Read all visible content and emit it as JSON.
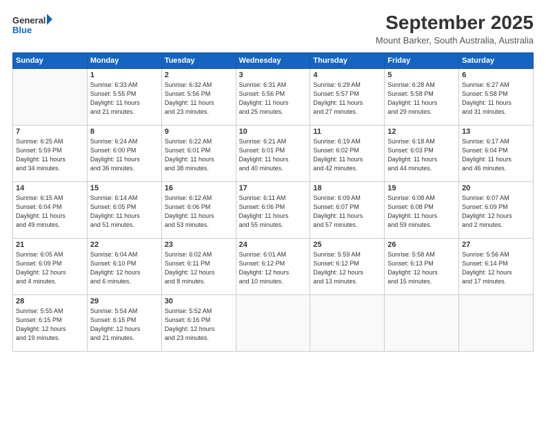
{
  "header": {
    "logo_line1": "General",
    "logo_line2": "Blue",
    "month": "September 2025",
    "location": "Mount Barker, South Australia, Australia"
  },
  "days_of_week": [
    "Sunday",
    "Monday",
    "Tuesday",
    "Wednesday",
    "Thursday",
    "Friday",
    "Saturday"
  ],
  "weeks": [
    [
      {
        "day": "",
        "info": ""
      },
      {
        "day": "1",
        "info": "Sunrise: 6:33 AM\nSunset: 5:55 PM\nDaylight: 11 hours\nand 21 minutes."
      },
      {
        "day": "2",
        "info": "Sunrise: 6:32 AM\nSunset: 5:56 PM\nDaylight: 11 hours\nand 23 minutes."
      },
      {
        "day": "3",
        "info": "Sunrise: 6:31 AM\nSunset: 5:56 PM\nDaylight: 11 hours\nand 25 minutes."
      },
      {
        "day": "4",
        "info": "Sunrise: 6:29 AM\nSunset: 5:57 PM\nDaylight: 11 hours\nand 27 minutes."
      },
      {
        "day": "5",
        "info": "Sunrise: 6:28 AM\nSunset: 5:58 PM\nDaylight: 11 hours\nand 29 minutes."
      },
      {
        "day": "6",
        "info": "Sunrise: 6:27 AM\nSunset: 5:58 PM\nDaylight: 11 hours\nand 31 minutes."
      }
    ],
    [
      {
        "day": "7",
        "info": "Sunrise: 6:25 AM\nSunset: 5:59 PM\nDaylight: 11 hours\nand 34 minutes."
      },
      {
        "day": "8",
        "info": "Sunrise: 6:24 AM\nSunset: 6:00 PM\nDaylight: 11 hours\nand 36 minutes."
      },
      {
        "day": "9",
        "info": "Sunrise: 6:22 AM\nSunset: 6:01 PM\nDaylight: 11 hours\nand 38 minutes."
      },
      {
        "day": "10",
        "info": "Sunrise: 6:21 AM\nSunset: 6:01 PM\nDaylight: 11 hours\nand 40 minutes."
      },
      {
        "day": "11",
        "info": "Sunrise: 6:19 AM\nSunset: 6:02 PM\nDaylight: 11 hours\nand 42 minutes."
      },
      {
        "day": "12",
        "info": "Sunrise: 6:18 AM\nSunset: 6:03 PM\nDaylight: 11 hours\nand 44 minutes."
      },
      {
        "day": "13",
        "info": "Sunrise: 6:17 AM\nSunset: 6:04 PM\nDaylight: 11 hours\nand 46 minutes."
      }
    ],
    [
      {
        "day": "14",
        "info": "Sunrise: 6:15 AM\nSunset: 6:04 PM\nDaylight: 11 hours\nand 49 minutes."
      },
      {
        "day": "15",
        "info": "Sunrise: 6:14 AM\nSunset: 6:05 PM\nDaylight: 11 hours\nand 51 minutes."
      },
      {
        "day": "16",
        "info": "Sunrise: 6:12 AM\nSunset: 6:06 PM\nDaylight: 11 hours\nand 53 minutes."
      },
      {
        "day": "17",
        "info": "Sunrise: 6:11 AM\nSunset: 6:06 PM\nDaylight: 11 hours\nand 55 minutes."
      },
      {
        "day": "18",
        "info": "Sunrise: 6:09 AM\nSunset: 6:07 PM\nDaylight: 11 hours\nand 57 minutes."
      },
      {
        "day": "19",
        "info": "Sunrise: 6:08 AM\nSunset: 6:08 PM\nDaylight: 11 hours\nand 59 minutes."
      },
      {
        "day": "20",
        "info": "Sunrise: 6:07 AM\nSunset: 6:09 PM\nDaylight: 12 hours\nand 2 minutes."
      }
    ],
    [
      {
        "day": "21",
        "info": "Sunrise: 6:05 AM\nSunset: 6:09 PM\nDaylight: 12 hours\nand 4 minutes."
      },
      {
        "day": "22",
        "info": "Sunrise: 6:04 AM\nSunset: 6:10 PM\nDaylight: 12 hours\nand 6 minutes."
      },
      {
        "day": "23",
        "info": "Sunrise: 6:02 AM\nSunset: 6:11 PM\nDaylight: 12 hours\nand 8 minutes."
      },
      {
        "day": "24",
        "info": "Sunrise: 6:01 AM\nSunset: 6:12 PM\nDaylight: 12 hours\nand 10 minutes."
      },
      {
        "day": "25",
        "info": "Sunrise: 5:59 AM\nSunset: 6:12 PM\nDaylight: 12 hours\nand 13 minutes."
      },
      {
        "day": "26",
        "info": "Sunrise: 5:58 AM\nSunset: 6:13 PM\nDaylight: 12 hours\nand 15 minutes."
      },
      {
        "day": "27",
        "info": "Sunrise: 5:56 AM\nSunset: 6:14 PM\nDaylight: 12 hours\nand 17 minutes."
      }
    ],
    [
      {
        "day": "28",
        "info": "Sunrise: 5:55 AM\nSunset: 6:15 PM\nDaylight: 12 hours\nand 19 minutes."
      },
      {
        "day": "29",
        "info": "Sunrise: 5:54 AM\nSunset: 6:15 PM\nDaylight: 12 hours\nand 21 minutes."
      },
      {
        "day": "30",
        "info": "Sunrise: 5:52 AM\nSunset: 6:16 PM\nDaylight: 12 hours\nand 23 minutes."
      },
      {
        "day": "",
        "info": ""
      },
      {
        "day": "",
        "info": ""
      },
      {
        "day": "",
        "info": ""
      },
      {
        "day": "",
        "info": ""
      }
    ]
  ]
}
